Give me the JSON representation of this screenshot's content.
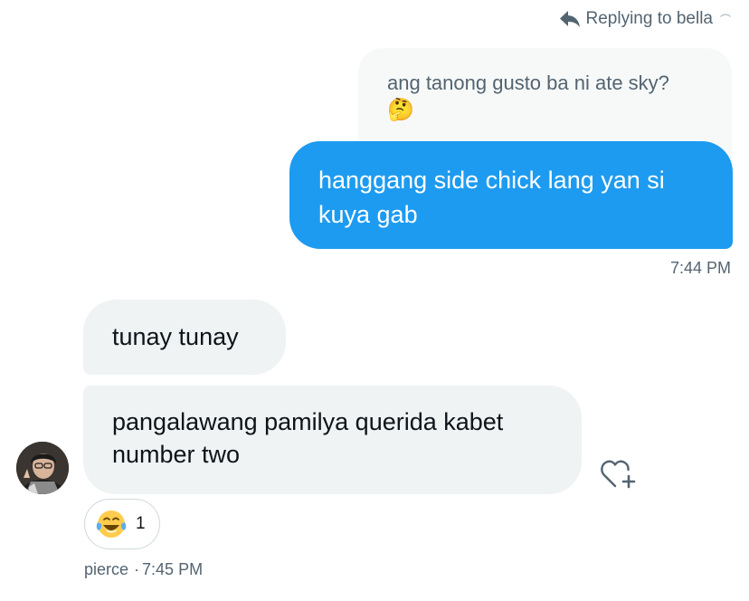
{
  "reply_header": {
    "text": "Replying to bella",
    "trailing_emoji": "⌒"
  },
  "quoted_message": {
    "text": "ang tanong gusto ba ni ate sky?",
    "emoji": "🤔"
  },
  "sent_message": {
    "text": "hanggang side chick lang yan si kuya gab",
    "time": "7:44 PM"
  },
  "received_messages": [
    {
      "text": "tunay tunay"
    },
    {
      "text": "pangalawang pamilya querida kabet number two"
    }
  ],
  "reaction": {
    "emoji": "😂",
    "emoji_name": "face-with-tears-of-joy",
    "count": "1"
  },
  "sender_meta": {
    "name": "pierce",
    "separator": "·",
    "time": "7:45 PM"
  },
  "icons": {
    "reply": "reply-arrow-icon",
    "add_reaction": "heart-plus-icon",
    "avatar": "user-avatar"
  },
  "colors": {
    "sent_bubble": "#1d9bf0",
    "received_bubble": "#eff3f4",
    "quoted_bubble": "#f7f9f9",
    "muted_text": "#536471"
  }
}
